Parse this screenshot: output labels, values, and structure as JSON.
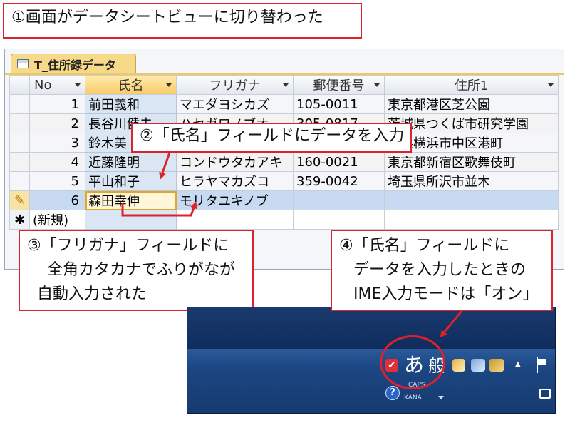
{
  "callout1": {
    "text": "①画面がデータシートビューに切り替わった"
  },
  "callout2": {
    "text": "②「氏名」フィールドにデータを入力"
  },
  "callout3": {
    "lines": [
      "③「フリガナ」フィールドに",
      "全角カタカナでふりがなが",
      "自動入力された"
    ]
  },
  "callout4": {
    "lines": [
      "④「氏名」フィールドに",
      "データを入力したときの",
      "IME入力モードは「オン」"
    ]
  },
  "table": {
    "tab_title": "T_住所録データ",
    "columns": [
      "No",
      "氏名",
      "フリガナ",
      "郵便番号",
      "住所1"
    ],
    "rows": [
      {
        "no": "1",
        "name": "前田義和",
        "kana": "マエダヨシカズ",
        "zip": "105-0011",
        "addr": "東京都港区芝公園"
      },
      {
        "no": "2",
        "name": "長谷川健夫",
        "kana": "ハセガワノブオ",
        "zip": "305-0817",
        "addr": "茨城県つくば市研究学園"
      },
      {
        "no": "3",
        "name": "鈴木美",
        "kana": "",
        "zip": "",
        "addr": "川県横浜市中区港町"
      },
      {
        "no": "4",
        "name": "近藤隆明",
        "kana": "コンドウタカアキ",
        "zip": "160-0021",
        "addr": "東京都新宿区歌舞伎町"
      },
      {
        "no": "5",
        "name": "平山和子",
        "kana": "ヒラヤマカズコ",
        "zip": "359-0042",
        "addr": "埼玉県所沢市並木"
      },
      {
        "no": "6",
        "name": "森田幸伸",
        "kana": "モリタユキノブ",
        "zip": "",
        "addr": ""
      }
    ],
    "new_row_label": "(新規)",
    "edit_indicator": "✎",
    "new_indicator": "✱"
  },
  "taskbar": {
    "ime_char": "あ",
    "ime_mode": "般",
    "caps_label": "CAPS",
    "kana_label": "KANA",
    "help_glyph": "?",
    "up_arrow": "▲"
  },
  "colors": {
    "callout_border": "#d9232d",
    "selection": "#c7daf2",
    "header_selected": "#f9c96a"
  }
}
